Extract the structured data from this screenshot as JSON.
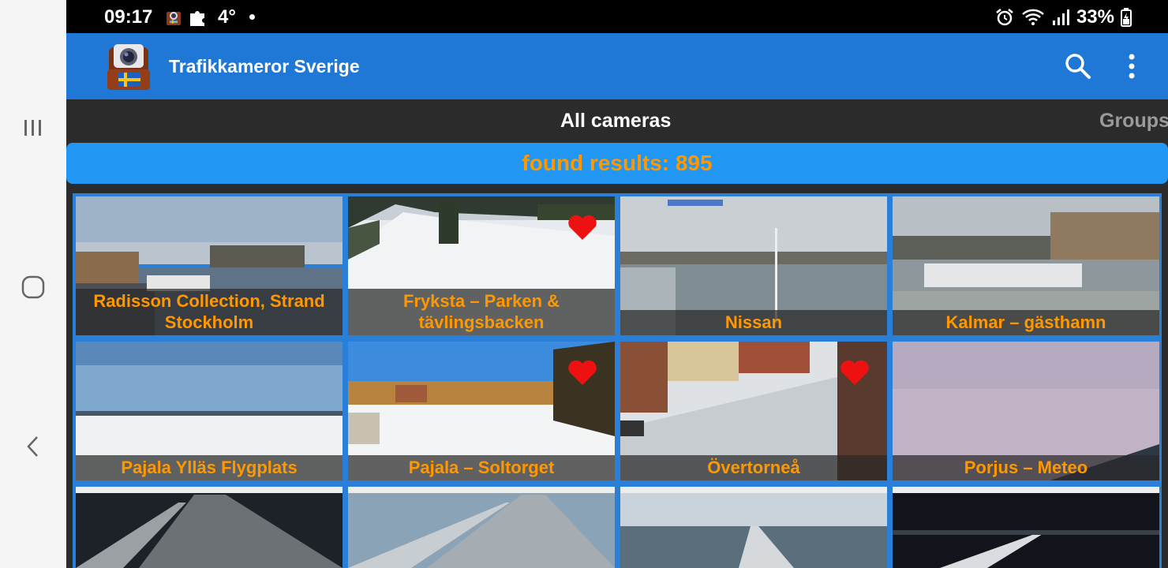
{
  "status": {
    "time": "09:17",
    "temperature": "4°",
    "battery": "33%",
    "icons": [
      "app-notification-icon",
      "puzzle-icon",
      "alarm-icon",
      "wifi-icon",
      "signal-icon",
      "battery-icon"
    ]
  },
  "app": {
    "title": "Trafikkameror Sverige",
    "actions": [
      "search-icon",
      "more-vert-icon"
    ]
  },
  "tabs": [
    {
      "label": "All cameras",
      "active": true
    },
    {
      "label": "Groups",
      "active": false
    }
  ],
  "results_text": "found results: 895",
  "cameras": [
    {
      "name": "Radisson Collection, Strand Stockholm",
      "favorite": false
    },
    {
      "name": "Fryksta – Parken & tävlingsbacken",
      "favorite": true
    },
    {
      "name": "Nissan",
      "favorite": false
    },
    {
      "name": "Kalmar – gästhamn",
      "favorite": false
    },
    {
      "name": "Pajala Ylläs Flygplats",
      "favorite": false
    },
    {
      "name": "Pajala – Soltorget",
      "favorite": true
    },
    {
      "name": "Övertorneå",
      "favorite": true
    },
    {
      "name": "Porjus – Meteo",
      "favorite": false
    },
    {
      "name": "",
      "favorite": false
    },
    {
      "name": "",
      "favorite": false
    },
    {
      "name": "",
      "favorite": false
    },
    {
      "name": "",
      "favorite": false
    }
  ],
  "colors": {
    "appbar": "#1f78d6",
    "results_bar": "#2196f3",
    "accent_text": "#ff9800",
    "heart": "#ee1111"
  },
  "system_nav": [
    "recents-icon",
    "home-icon",
    "back-icon"
  ]
}
